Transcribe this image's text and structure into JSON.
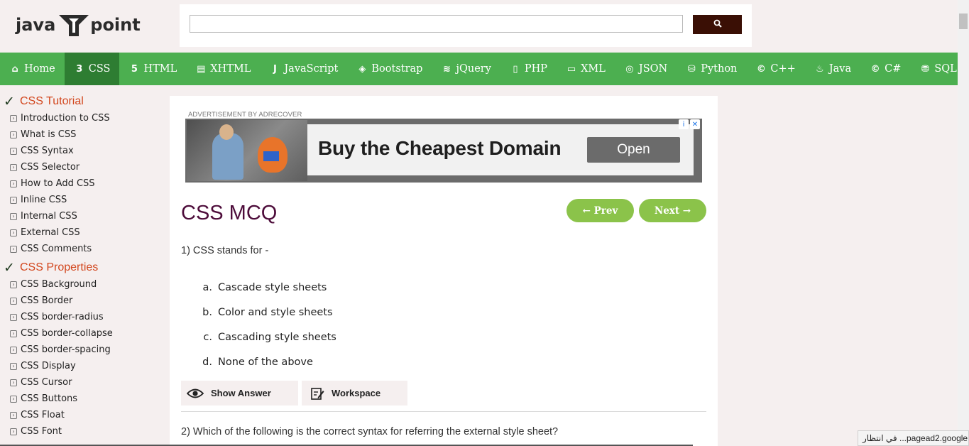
{
  "header": {
    "logo_left": "java",
    "logo_right": "point",
    "search_placeholder": "",
    "search_icon": "search-icon"
  },
  "nav": {
    "items": [
      {
        "label": "Home",
        "icon": "home-icon",
        "active": false
      },
      {
        "label": "CSS",
        "icon": "css3-icon",
        "active": true
      },
      {
        "label": "HTML",
        "icon": "html5-icon",
        "active": false
      },
      {
        "label": "XHTML",
        "icon": "document-icon",
        "active": false
      },
      {
        "label": "JavaScript",
        "icon": "javascript-icon",
        "active": false
      },
      {
        "label": "Bootstrap",
        "icon": "layers-icon",
        "active": false
      },
      {
        "label": "jQuery",
        "icon": "jquery-icon",
        "active": false
      },
      {
        "label": "PHP",
        "icon": "file-icon",
        "active": false
      },
      {
        "label": "XML",
        "icon": "file-code-icon",
        "active": false
      },
      {
        "label": "JSON",
        "icon": "json-icon",
        "active": false
      },
      {
        "label": "Python",
        "icon": "python-icon",
        "active": false
      },
      {
        "label": "C++",
        "icon": "cpp-icon",
        "active": false
      },
      {
        "label": "Java",
        "icon": "java-icon",
        "active": false
      },
      {
        "label": "C#",
        "icon": "csharp-icon",
        "active": false
      },
      {
        "label": "SQL",
        "icon": "database-icon",
        "active": false
      }
    ]
  },
  "sidebar": {
    "sections": [
      {
        "title": "CSS Tutorial",
        "items": [
          "Introduction to CSS",
          "What is CSS",
          "CSS Syntax",
          "CSS Selector",
          "How to Add CSS",
          "Inline CSS",
          "Internal CSS",
          "External CSS",
          "CSS Comments"
        ]
      },
      {
        "title": "CSS Properties",
        "items": [
          "CSS Background",
          "CSS Border",
          "CSS border-radius",
          "CSS border-collapse",
          "CSS border-spacing",
          "CSS Display",
          "CSS Cursor",
          "CSS Buttons",
          "CSS Float",
          "CSS Font"
        ]
      }
    ]
  },
  "ad": {
    "label": "ADVERTISEMENT BY ADRECOVER",
    "headline": "Buy the Cheapest Domain",
    "button": "Open",
    "info_glyph": "i",
    "close_glyph": "✕"
  },
  "main": {
    "title": "CSS MCQ",
    "prev_label": "← Prev",
    "next_label": "Next →",
    "q1": "1) CSS stands for -",
    "options": [
      {
        "letter": "a.",
        "text": "Cascade style sheets"
      },
      {
        "letter": "b.",
        "text": "Color and style sheets"
      },
      {
        "letter": "c.",
        "text": "Cascading style sheets"
      },
      {
        "letter": "d.",
        "text": "None of the above"
      }
    ],
    "show_answer": "Show Answer",
    "workspace": "Workspace",
    "q2": "2) Which of the following is the correct syntax for referring the external style sheet?"
  },
  "status": {
    "text": "في انتظار ...pagead2.google"
  },
  "colors": {
    "nav_bg": "#4caf50",
    "nav_active": "#2e7d32",
    "title": "#4d0c3a",
    "sidebar_heading": "#d2461d",
    "pager_btn": "#8bc34a",
    "search_btn": "#3a0f05"
  }
}
